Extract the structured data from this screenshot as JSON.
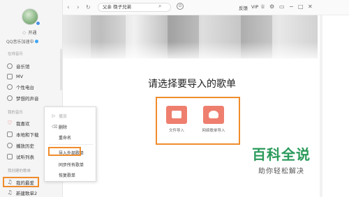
{
  "sidebar": {
    "vip_label": "开通",
    "account_text": "QQ音乐加速中",
    "sections": [
      {
        "title": "在线音乐"
      },
      {
        "title": "我的音乐"
      },
      {
        "title": "我创建的歌单"
      }
    ],
    "items": [
      {
        "label": "音乐馆",
        "icon": "music-hall-icon"
      },
      {
        "label": "MV",
        "icon": "mv-icon"
      },
      {
        "label": "个性电台",
        "icon": "radio-icon"
      },
      {
        "label": "梦想的声音",
        "icon": "dream-voice-icon"
      },
      {
        "label": "我喜欢",
        "icon": "heart-icon"
      },
      {
        "label": "本地和下载",
        "icon": "download-icon"
      },
      {
        "label": "播放历史",
        "icon": "history-icon"
      },
      {
        "label": "试听列表",
        "icon": "trial-list-icon"
      },
      {
        "label": "我的最爱",
        "icon": "music-note-icon"
      },
      {
        "label": "新建歌单2",
        "icon": "music-note-icon"
      }
    ]
  },
  "topbar": {
    "search_value": "父亲 筷子兄弟",
    "feedback": "反馈",
    "vip": "VIP"
  },
  "main": {
    "heading": "请选择要导入的歌单",
    "import_options": [
      {
        "label": "文件导入",
        "icon": "file-import-icon"
      },
      {
        "label": "网络歌单导入",
        "icon": "online-import-icon"
      }
    ]
  },
  "context_menu": {
    "items": [
      {
        "label": "播放",
        "disabled": true
      },
      {
        "label": "删除",
        "disabled": false
      },
      {
        "label": "重命名",
        "disabled": false
      },
      {
        "label": "导入外部歌单",
        "disabled": false
      },
      {
        "label": "同步所有歌单",
        "disabled": false
      },
      {
        "label": "恢复歌单",
        "disabled": false
      }
    ]
  },
  "watermark": {
    "title": "百科全说",
    "subtitle": "助你轻松解决"
  },
  "colors": {
    "highlight": "#f08c2b",
    "tile": "#ee7f6f",
    "watermark": "#2a9a5a"
  }
}
